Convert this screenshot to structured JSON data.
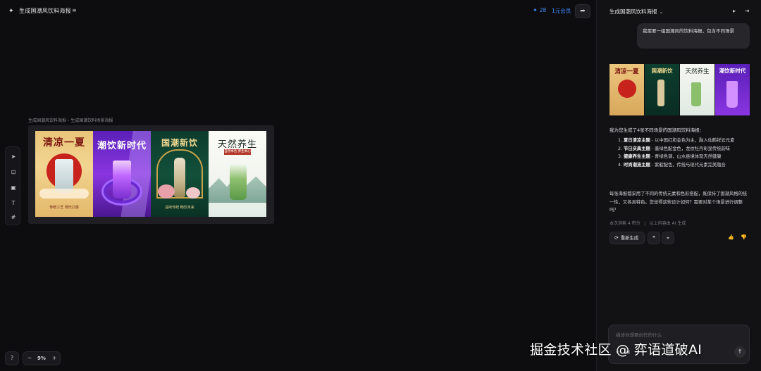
{
  "header": {
    "project_title": "生成国潮风饮料海报",
    "credits": "28",
    "vip_label": "1元会员"
  },
  "canvas": {
    "breadcrumb": [
      "生成国潮风饮料海报",
      "生成国潮饮料场景海报"
    ],
    "posters": [
      {
        "title": "清凉一夏",
        "subtitle": "传统工艺 现代口感"
      },
      {
        "title": "潮饮新时代",
        "subtitle": ""
      },
      {
        "title": "国潮新饮",
        "subtitle": "品味传统 畅饮未来"
      },
      {
        "title": "天然养生",
        "subtitle": "自然本色 养生本心"
      }
    ],
    "zoom": "9%"
  },
  "chat": {
    "title": "生成国潮风饮料海报",
    "user_message": "我需要一组国潮风的饮料海报，包含不同场景",
    "thumbnails": [
      "清凉一夏",
      "国潮新饮",
      "天然养生",
      "潮饮新时代"
    ],
    "reply_intro": "我为您生成了4张不同场景的国潮风饮料海报：",
    "reply_items": [
      {
        "num": "1.",
        "bold": "夏日清凉主题",
        "text": " - 以中国红和金色为主，融入仙鹤祥云元素"
      },
      {
        "num": "2.",
        "bold": "节日庆典主题",
        "text": " - 墨绿色配金色，龙纹牡丹彰显传统韵味"
      },
      {
        "num": "3.",
        "bold": "健康养生主题",
        "text": " - 青绿色调，山水县境体现天然健康"
      },
      {
        "num": "4.",
        "bold": "时尚潮流主题",
        "text": " - 紫靛配色，传统与现代元素完美融合"
      }
    ],
    "reply_summary": "每张海报都采用了不同的传统元素和色彩搭配，既保持了国潮风格的统一性，又各具特色。您觉得这些设计如何？需要对某个场景进行调整吗？",
    "meta_cost": "本次消耗 4 积分",
    "meta_ai": "以上内容由 AI 生成",
    "regen_label": "重新生成",
    "input_placeholder": "描述你想要创作的什么"
  },
  "watermark": "掘金技术社区 @ 弈语道破AI",
  "colors": {
    "accent": "#3d8cff",
    "background": "#0d0d0f",
    "panel": "#121215"
  }
}
